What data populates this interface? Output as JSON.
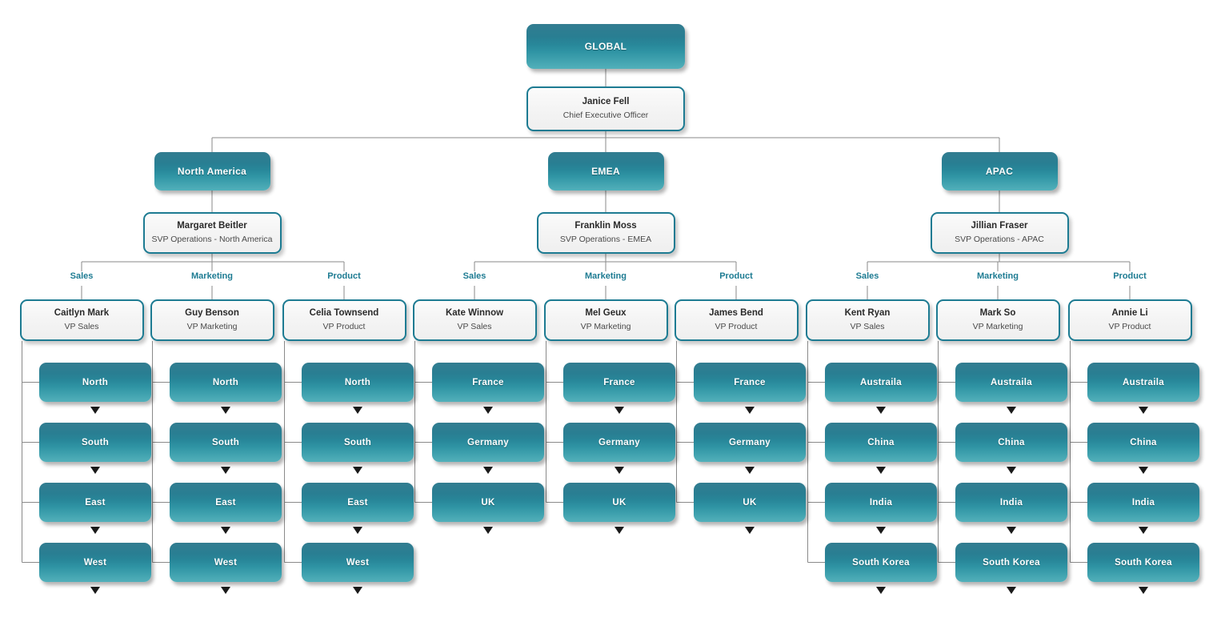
{
  "theme": {
    "accent": "#1d7b92",
    "box_gradient_top": "#1b6e84",
    "box_gradient_bottom": "#52b0ba",
    "card_border": "#1d7b92",
    "card_fill": "#f4f4f4",
    "connector_line": "#8a8a8a",
    "function_label_color": "#1d7b92",
    "arrow_color": "#1a1a1a",
    "page_background": "#ffffff"
  },
  "chart_title": "GLOBAL",
  "root": {
    "unit": "GLOBAL",
    "leader_name": "Janice Fell",
    "leader_title": "Chief Executive Officer"
  },
  "function_labels": [
    "Sales",
    "Marketing",
    "Product"
  ],
  "regions": [
    {
      "unit": "North America",
      "leader_name": "Margaret Beitler",
      "leader_title": "SVP Operations - North America",
      "functions": [
        {
          "label": "Sales",
          "vp_name": "Caitlyn Mark",
          "vp_title": "VP Sales",
          "territories": [
            "North",
            "South",
            "East",
            "West"
          ]
        },
        {
          "label": "Marketing",
          "vp_name": "Guy Benson",
          "vp_title": "VP Marketing",
          "territories": [
            "North",
            "South",
            "East",
            "West"
          ]
        },
        {
          "label": "Product",
          "vp_name": "Celia Townsend",
          "vp_title": "VP Product",
          "territories": [
            "North",
            "South",
            "East",
            "West"
          ]
        }
      ]
    },
    {
      "unit": "EMEA",
      "leader_name": "Franklin Moss",
      "leader_title": "SVP Operations - EMEA",
      "functions": [
        {
          "label": "Sales",
          "vp_name": "Kate Winnow",
          "vp_title": "VP Sales",
          "territories": [
            "France",
            "Germany",
            "UK"
          ]
        },
        {
          "label": "Marketing",
          "vp_name": "Mel Geux",
          "vp_title": "VP Marketing",
          "territories": [
            "France",
            "Germany",
            "UK"
          ]
        },
        {
          "label": "Product",
          "vp_name": "James Bend",
          "vp_title": "VP Product",
          "territories": [
            "France",
            "Germany",
            "UK"
          ]
        }
      ]
    },
    {
      "unit": "APAC",
      "leader_name": "Jillian Fraser",
      "leader_title": "SVP Operations - APAC",
      "functions": [
        {
          "label": "Sales",
          "vp_name": "Kent Ryan",
          "vp_title": "VP Sales",
          "territories": [
            "Austraila",
            "China",
            "India",
            "South Korea"
          ]
        },
        {
          "label": "Marketing",
          "vp_name": "Mark So",
          "vp_title": "VP Marketing",
          "territories": [
            "Austraila",
            "China",
            "India",
            "South Korea"
          ]
        },
        {
          "label": "Product",
          "vp_name": "Annie Li",
          "vp_title": "VP Product",
          "territories": [
            "Austraila",
            "China",
            "India",
            "South Korea"
          ]
        }
      ]
    }
  ]
}
